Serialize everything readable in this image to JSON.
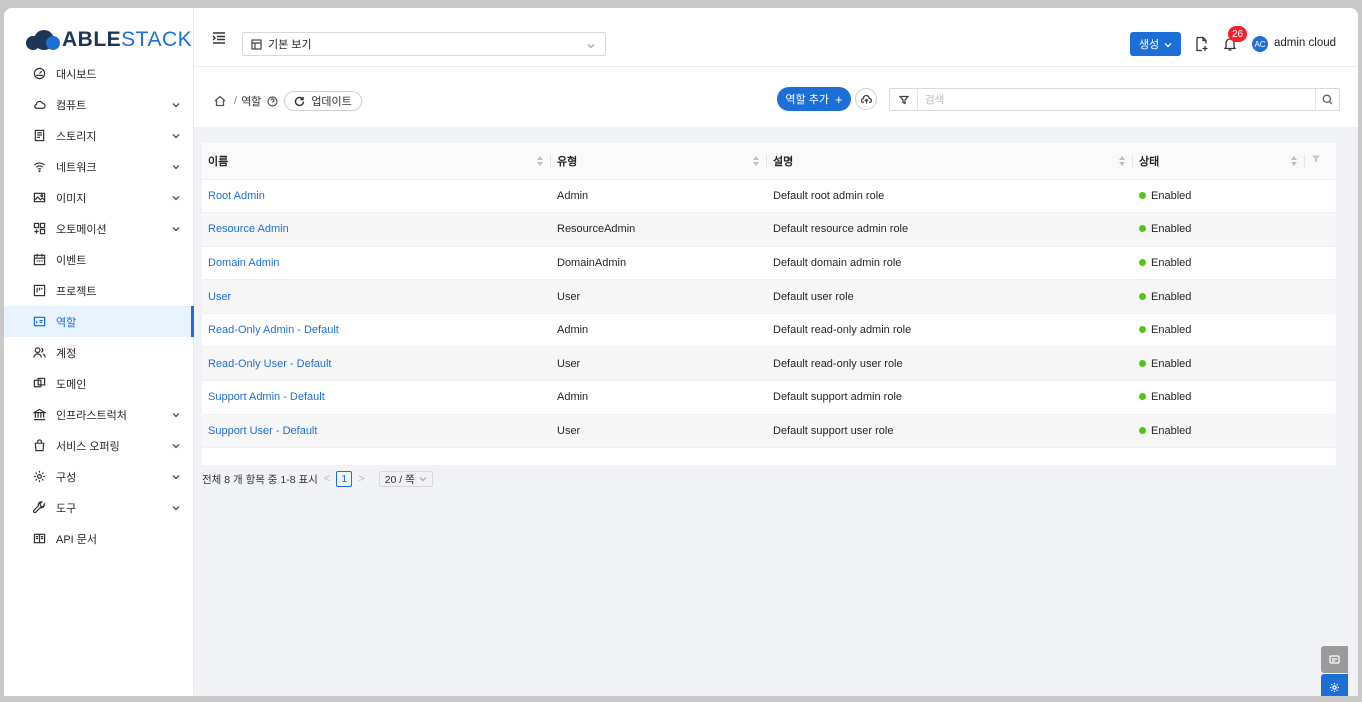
{
  "brand": {
    "part1": "ABLE",
    "part2": "STACK"
  },
  "sidebar": {
    "items": [
      {
        "label": "대시보드",
        "icon": "dashboard-icon",
        "expandable": false
      },
      {
        "label": "컴퓨트",
        "icon": "cloud-icon",
        "expandable": true
      },
      {
        "label": "스토리지",
        "icon": "storage-icon",
        "expandable": true
      },
      {
        "label": "네트워크",
        "icon": "wifi-icon",
        "expandable": true
      },
      {
        "label": "이미지",
        "icon": "picture-icon",
        "expandable": true
      },
      {
        "label": "오토메이션",
        "icon": "automation-icon",
        "expandable": true
      },
      {
        "label": "이벤트",
        "icon": "calendar-icon",
        "expandable": false
      },
      {
        "label": "프로젝트",
        "icon": "project-icon",
        "expandable": false
      },
      {
        "label": "역할",
        "icon": "idcard-icon",
        "expandable": false,
        "active": true
      },
      {
        "label": "계정",
        "icon": "users-icon",
        "expandable": false
      },
      {
        "label": "도메인",
        "icon": "block-icon",
        "expandable": false
      },
      {
        "label": "인프라스트럭처",
        "icon": "bank-icon",
        "expandable": true
      },
      {
        "label": "서비스 오퍼링",
        "icon": "shopping-icon",
        "expandable": true
      },
      {
        "label": "구성",
        "icon": "setting-icon",
        "expandable": true
      },
      {
        "label": "도구",
        "icon": "tool-icon",
        "expandable": true
      },
      {
        "label": "API 문서",
        "icon": "book-icon",
        "expandable": false
      }
    ]
  },
  "header": {
    "view_select": "기본 보기",
    "create_label": "생성",
    "notification_count": "26",
    "avatar_initials": "AC",
    "username": "admin cloud"
  },
  "toolbar": {
    "breadcrumb_current": "역할",
    "update_label": "업데이트",
    "add_role_label": "역할 추가",
    "search_placeholder": "검색"
  },
  "table": {
    "columns": [
      "이름",
      "유형",
      "설명",
      "상태"
    ],
    "rows": [
      {
        "name": "Root Admin",
        "type": "Admin",
        "description": "Default root admin role",
        "state": "Enabled"
      },
      {
        "name": "Resource Admin",
        "type": "ResourceAdmin",
        "description": "Default resource admin role",
        "state": "Enabled"
      },
      {
        "name": "Domain Admin",
        "type": "DomainAdmin",
        "description": "Default domain admin role",
        "state": "Enabled"
      },
      {
        "name": "User",
        "type": "User",
        "description": "Default user role",
        "state": "Enabled"
      },
      {
        "name": "Read-Only Admin - Default",
        "type": "Admin",
        "description": "Default read-only admin role",
        "state": "Enabled"
      },
      {
        "name": "Read-Only User - Default",
        "type": "User",
        "description": "Default read-only user role",
        "state": "Enabled"
      },
      {
        "name": "Support Admin - Default",
        "type": "Admin",
        "description": "Default support admin role",
        "state": "Enabled"
      },
      {
        "name": "Support User - Default",
        "type": "User",
        "description": "Default support user role",
        "state": "Enabled"
      }
    ]
  },
  "pagination": {
    "summary": "전체 8 개 항목 중 1-8 표시",
    "current_page": "1",
    "page_size": "20 / 쪽"
  },
  "colors": {
    "accent": "#1d6fd8",
    "enabled": "#52c41a",
    "badge": "#f5222d"
  }
}
